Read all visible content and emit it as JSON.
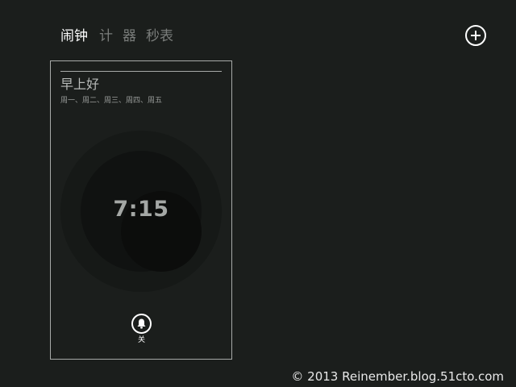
{
  "tabs": [
    {
      "label": "闹钟",
      "active": true
    },
    {
      "label": "计",
      "active": false
    },
    {
      "label": "器",
      "active": false
    },
    {
      "label": "秒表",
      "active": false
    }
  ],
  "toolbar": {
    "add_icon": "plus-circle-icon"
  },
  "alarm": {
    "name": "早上好",
    "days": "周一、周二、周三、周四、周五",
    "time": "7:15",
    "toggle_icon": "bell-icon",
    "toggle_label": "关"
  },
  "footer": {
    "watermark": "© 2013 Reinember.blog.51cto.com"
  },
  "colors": {
    "background": "#1b1e1c",
    "text_active": "#ffffff",
    "text_inactive": "#7a7d7b",
    "card_border": "#a7aaa8"
  }
}
